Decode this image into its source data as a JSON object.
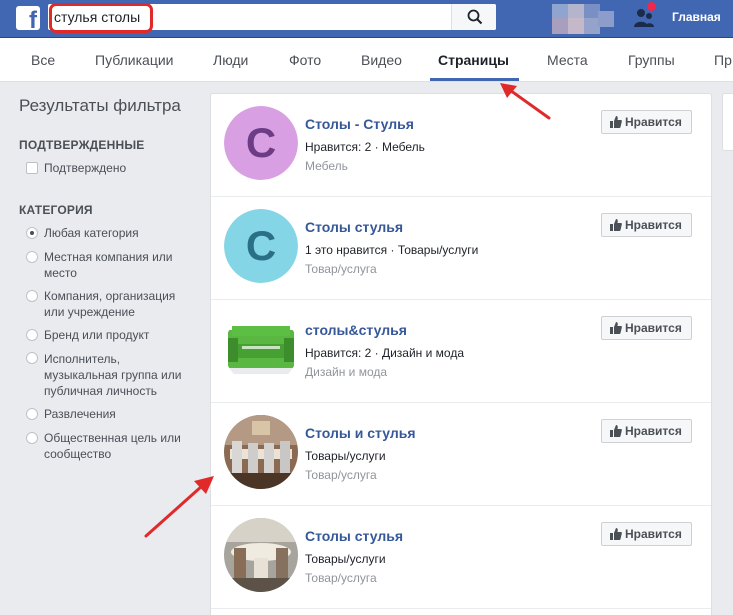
{
  "header": {
    "logo": "f",
    "search_value": "стулья столы",
    "home_label": "Главная",
    "icons": [
      "search-icon",
      "friend-requests-icon"
    ]
  },
  "tabs": [
    {
      "label": "Все"
    },
    {
      "label": "Публикации"
    },
    {
      "label": "Люди"
    },
    {
      "label": "Фото"
    },
    {
      "label": "Видео"
    },
    {
      "label": "Страницы",
      "active": true
    },
    {
      "label": "Места"
    },
    {
      "label": "Группы"
    },
    {
      "label": "Пр"
    }
  ],
  "sidebar": {
    "title": "Результаты фильтра",
    "verified_heading": "ПОДТВЕРЖДЕННЫЕ",
    "verified_option": "Подтверждено",
    "category_heading": "КАТЕГОРИЯ",
    "categories": [
      {
        "lines": [
          "Любая категория"
        ],
        "selected": true
      },
      {
        "lines": [
          "Местная компания или",
          "место"
        ]
      },
      {
        "lines": [
          "Компания, организация",
          "или учреждение"
        ]
      },
      {
        "lines": [
          "Бренд или продукт"
        ]
      },
      {
        "lines": [
          "Исполнитель,",
          "музыкальная группа или",
          "публичная личность"
        ]
      },
      {
        "lines": [
          "Развлечения"
        ]
      },
      {
        "lines": [
          "Общественная цель или",
          "сообщество"
        ]
      }
    ]
  },
  "results": [
    {
      "title": "Столы - Стулья",
      "meta": "Нравится: 2 · Мебель",
      "category": "Мебель",
      "avatar_letter": "С",
      "avatar_color": "#d8a0e3",
      "letter_color": "#6d3c86",
      "like": "Нравится"
    },
    {
      "title": "Столы стулья",
      "meta": "1 это нравится · Товары/услуги",
      "category": "Товар/услуга",
      "avatar_letter": "С",
      "avatar_color": "#84d6e6",
      "letter_color": "#2b6f86",
      "like": "Нравится"
    },
    {
      "title": "столы&стулья",
      "meta": "Нравится: 2 · Дизайн и мода",
      "category": "Дизайн и мода",
      "avatar_letter": "",
      "like": "Нравится"
    },
    {
      "title": "Столы и стулья",
      "meta": "Товары/услуги",
      "category": "Товар/услуга",
      "avatar_letter": "",
      "like": "Нравится"
    },
    {
      "title": "Столы стулья",
      "meta": "Товары/услуги",
      "category": "Товар/услуга",
      "avatar_letter": "",
      "like": "Нравится"
    }
  ],
  "colors": {
    "brand": "#4267b2",
    "link": "#365899",
    "highlight": "#e02a2a"
  }
}
